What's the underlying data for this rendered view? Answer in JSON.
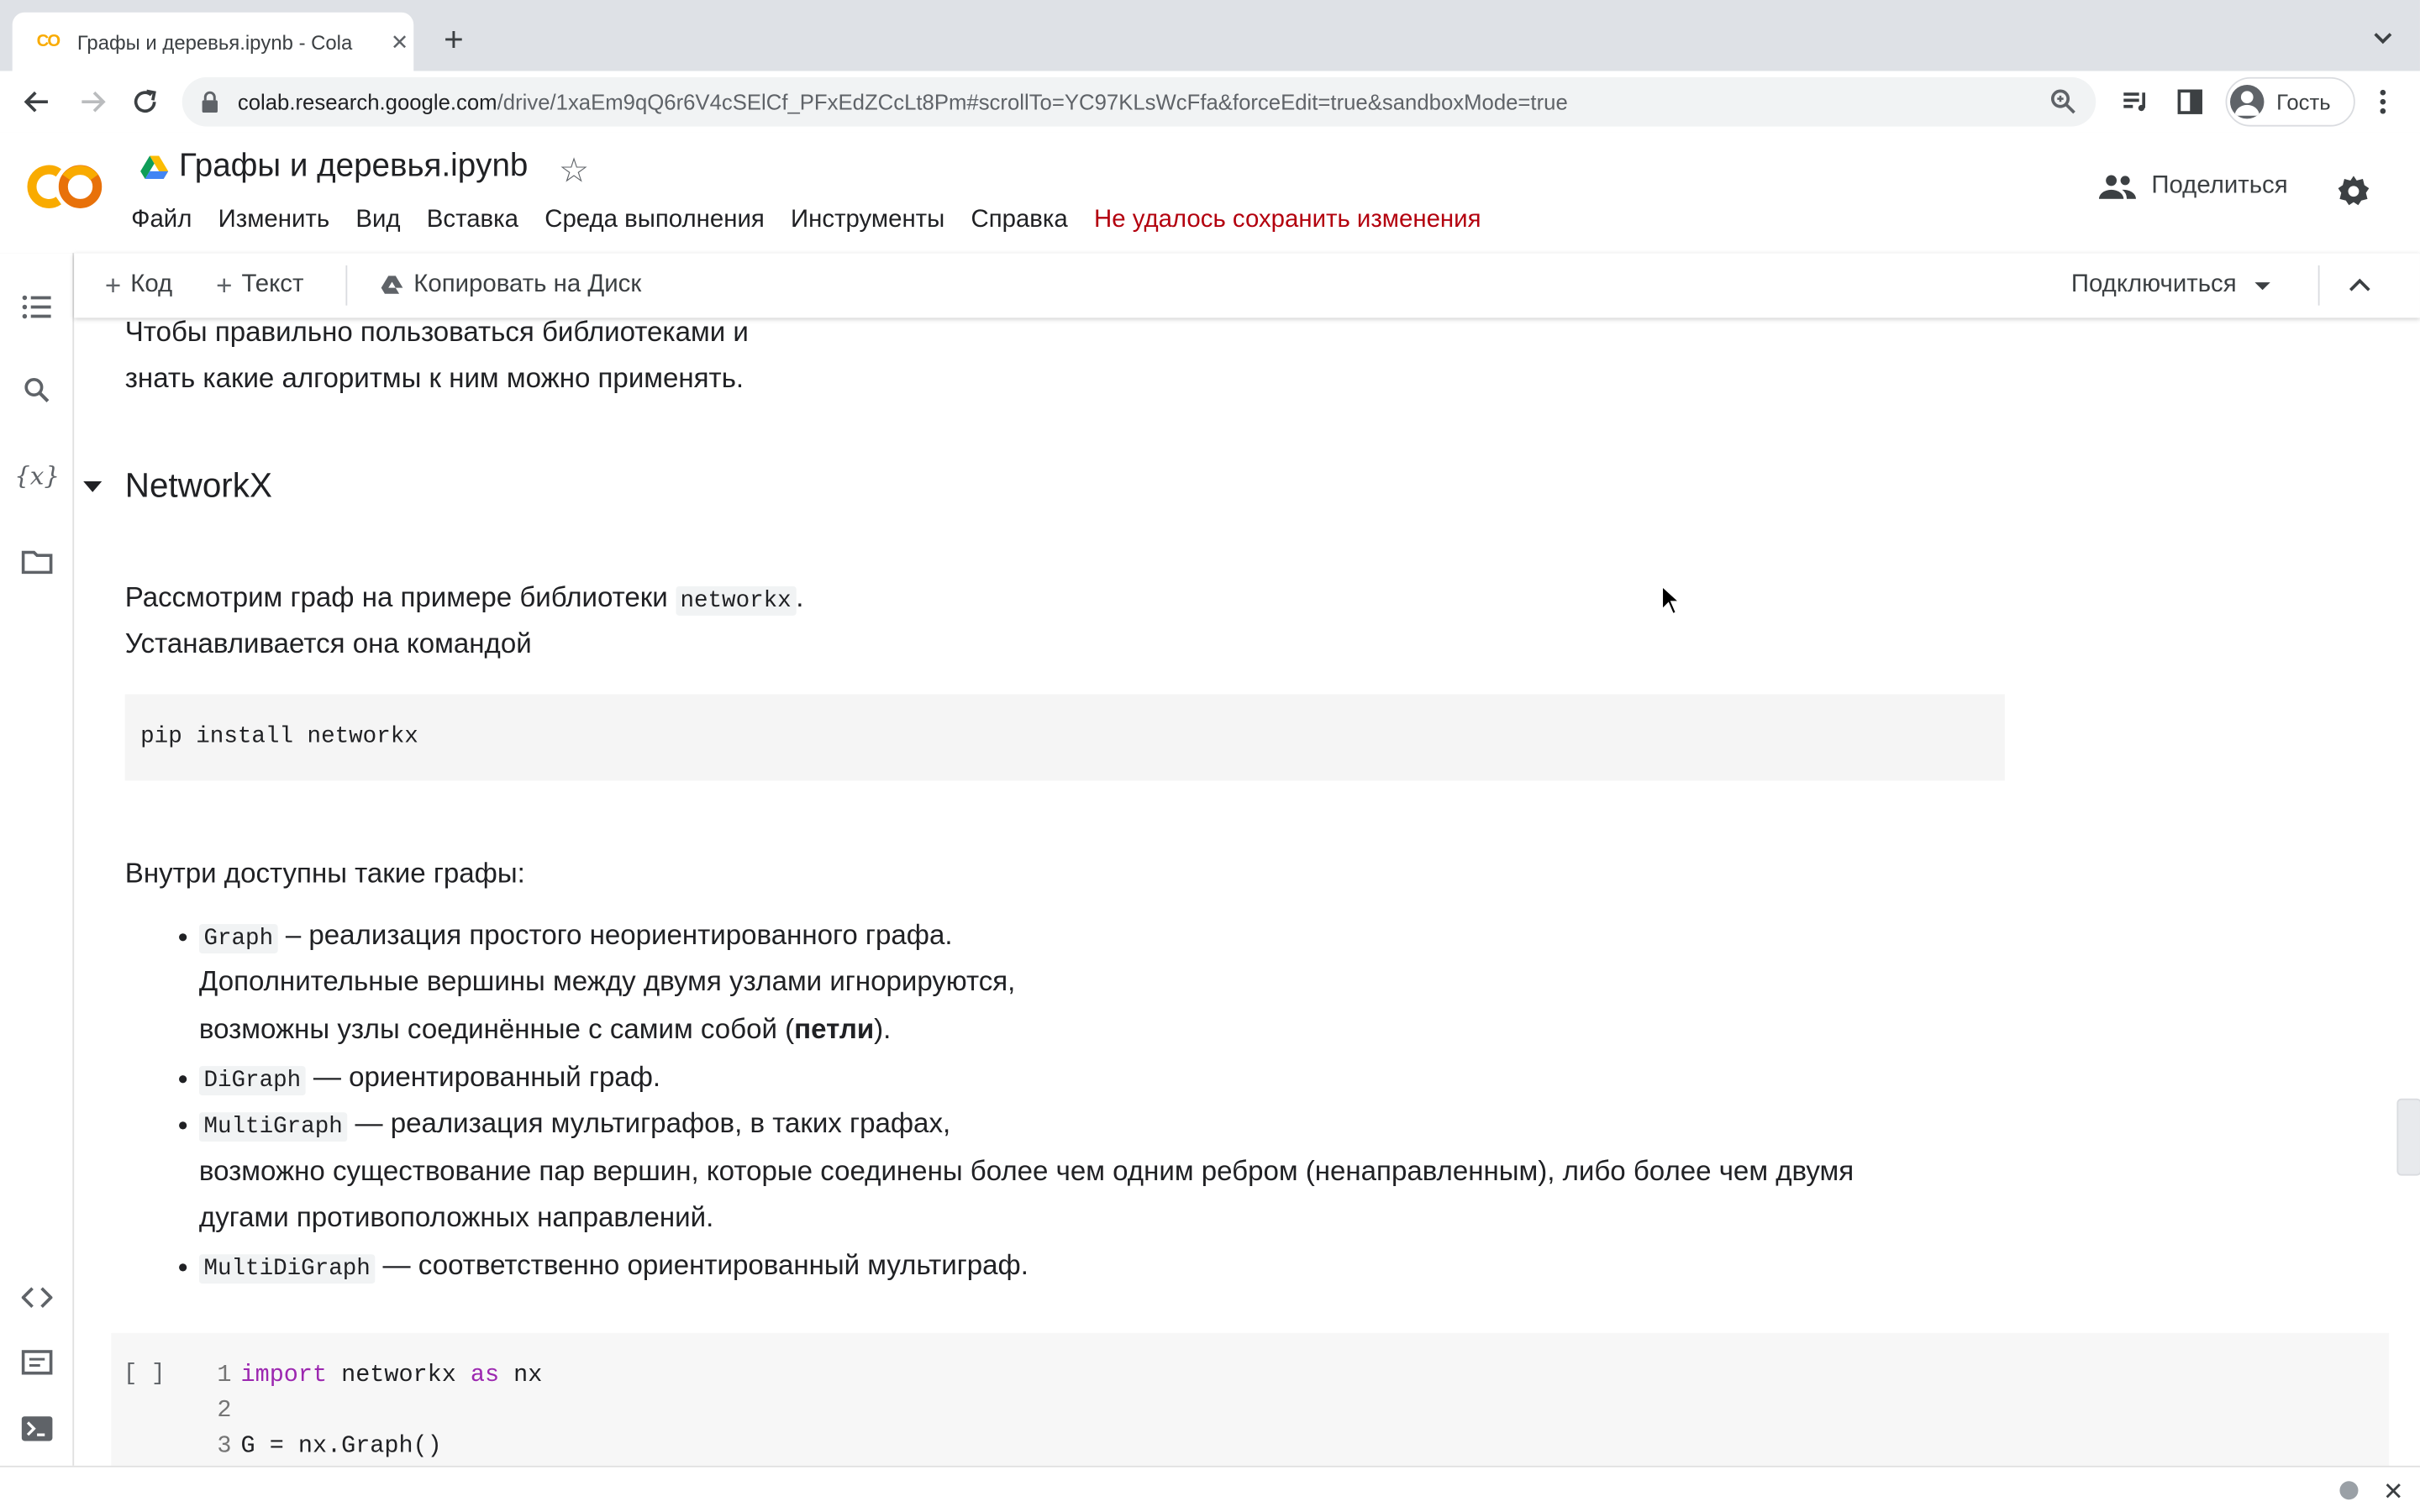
{
  "browser": {
    "tab_title": "Графы и деревья.ipynb - Cola",
    "favicon_text": "CO",
    "url_host": "colab.research.google.com",
    "url_path": "/drive/1xaEm9qQ6r6V4cSElCf_PFxEdZCcLt8Pm#scrollTo=YC97KLsWcFfa&forceEdit=true&sandboxMode=true",
    "profile_label": "Гость"
  },
  "header": {
    "notebook_title": "Графы и деревья.ipynb",
    "menu": [
      "Файл",
      "Изменить",
      "Вид",
      "Вставка",
      "Среда выполнения",
      "Инструменты",
      "Справка"
    ],
    "save_error": "Не удалось сохранить изменения",
    "share_label": "Поделиться"
  },
  "toolbar": {
    "add_code": "Код",
    "add_text": "Текст",
    "copy_to_drive": "Копировать на Диск",
    "connect": "Подключиться"
  },
  "content": {
    "intro_line1": "Чтобы правильно пользоваться библиотеками и",
    "intro_line2": "знать какие алгоритмы к ним можно применять.",
    "section_title": "NetworkX",
    "p1_text": "Рассмотрим граф на примере библиотеки",
    "p1_code": "networkx",
    "p1_end": ".",
    "p2": "Устанавливается она командой",
    "install_cmd": "pip install networkx",
    "graphs_intro": "Внутри доступны такие графы:",
    "bullets": [
      {
        "code": "Graph",
        "line1": " – реализация простого неориентированного графа.",
        "line2": "Дополнительные вершины между двумя узлами игнорируются,",
        "line3_a": "возможны узлы соединённые с самим собой (",
        "line3_b": "петли",
        "line3_c": ")."
      },
      {
        "code": "DiGraph",
        "line1": " — ориентированный граф."
      },
      {
        "code": "MultiGraph",
        "line1": " — реализация мультиграфов, в таких графах,",
        "line2": "возможно существование пар вершин, которые соединены более чем одним ребром (ненаправленным), либо более чем двумя",
        "line3": "дугами противоположных направлений."
      },
      {
        "code": "MultiDiGraph",
        "line1": " — соответственно ориентированный мультиграф."
      }
    ],
    "code_cell": {
      "run_label": "[ ]",
      "line_numbers": [
        "1",
        "2",
        "3"
      ],
      "line1_kw1": "import",
      "line1_mid": " networkx ",
      "line1_kw2": "as",
      "line1_end": " nx",
      "line3": "G = nx.Graph()"
    }
  }
}
